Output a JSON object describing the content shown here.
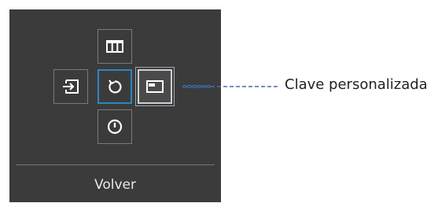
{
  "menu": {
    "buttons": [
      {
        "id": "top",
        "icon": "picture-size-icon"
      },
      {
        "id": "left",
        "icon": "source-input-icon"
      },
      {
        "id": "center",
        "icon": "return-icon",
        "state": "highlighted"
      },
      {
        "id": "right",
        "icon": "custom-key-icon",
        "state": "selected"
      },
      {
        "id": "bottom",
        "icon": "power-icon"
      }
    ],
    "back_label": "Volver"
  },
  "callout": {
    "label": "Clave personalizada"
  },
  "colors": {
    "panel_bg": "#3b3b3b",
    "highlight_blue": "#2f86c2",
    "callout_line": "#3a6fb0"
  }
}
